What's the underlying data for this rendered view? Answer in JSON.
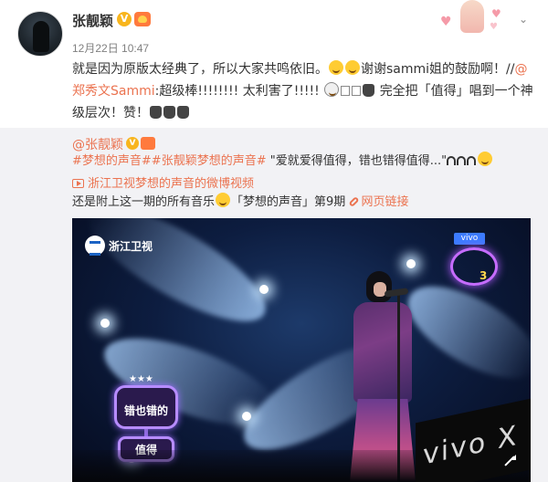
{
  "user": {
    "name": "张靓颖",
    "verified_badge": "V",
    "timestamp": "12月22日 10:47"
  },
  "post": {
    "text_part1": "就是因为原版太经典了，所以大家共鸣依旧。",
    "text_part2": "谢谢sammi姐的鼓励啊！//",
    "mention": "@郑秀文Sammi",
    "text_part3": ":超级棒!!!!!!!! 太利害了!!!!!",
    "text_part4": "完全把「值得」唱到一个神级层次！赞！"
  },
  "retweet": {
    "author": "@张靓颖",
    "hashtag1": "#梦想的声音#",
    "hashtag2": "#张靓颖梦想的声音#",
    "quote": "\"爱就爱得值得，错也错得值得...\"",
    "video_link": "浙江卫视梦想的声音的微博视频",
    "line3_text": "还是附上这一期的所有音乐",
    "line3_text2": "「梦想的声音」第9期",
    "web_link": "网页链接"
  },
  "image": {
    "channel_logo": "浙江卫视",
    "show_badge": "vivo",
    "show_number": "3",
    "sign_top": "错也错的",
    "sign_bottom": "值得",
    "screen_text": "vivo X"
  },
  "colors": {
    "link": "#eb7350",
    "verified": "#f8b51d",
    "retweet_bg": "#f2f2f5"
  }
}
